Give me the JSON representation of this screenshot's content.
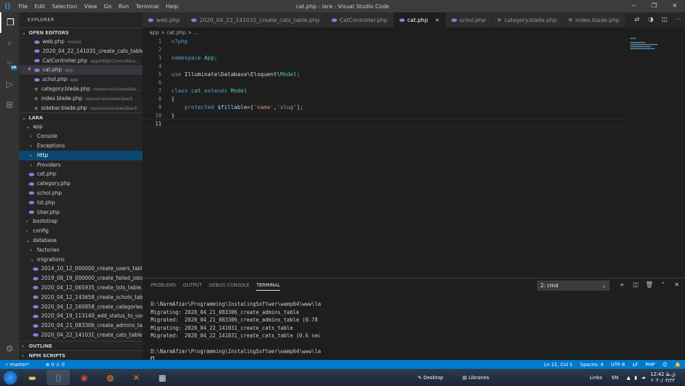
{
  "window": {
    "title": "cat.php - lara - Visual Studio Code",
    "menu": [
      "File",
      "Edit",
      "Selection",
      "View",
      "Go",
      "Run",
      "Terminal",
      "Help"
    ]
  },
  "activity_badge": "SK",
  "sidebar": {
    "header": "EXPLORER",
    "open_editors_title": "OPEN EDITORS",
    "open_editors": [
      {
        "name": "web.php",
        "path": "routes"
      },
      {
        "name": "2020_04_22_141031_create_cats_table...",
        "path": ""
      },
      {
        "name": "CatController.php",
        "path": "app\\Http\\Controllers..."
      },
      {
        "name": "cat.php",
        "path": "app"
      },
      {
        "name": "schol.php",
        "path": "app"
      },
      {
        "name": "category.blade.php",
        "path": "resources\\views\\ba..."
      },
      {
        "name": "index.blade.php",
        "path": "resources\\views\\back"
      },
      {
        "name": "sidebar.blade.php",
        "path": "resources\\views\\back"
      }
    ],
    "project_title": "LARA",
    "tree": [
      "app",
      "Console",
      "Exceptions",
      "Http",
      "Providers",
      "cat.php",
      "category.php",
      "schol.php",
      "tst.php",
      "User.php",
      "bootstrap",
      "config",
      "database",
      "factories",
      "migrations",
      "2014_10_12_000000_create_users_table....",
      "2019_08_19_000000_create_failed_jobs...",
      "2020_04_12_065935_create_tsts_table.p...",
      "2020_04_12_143658_create_schols_tabl...",
      "2020_04_12_160858_create_categories_...",
      "2020_04_19_113140_add_status_to_use...",
      "2020_04_21_083306_create_admins_ta...",
      "2020_04_22_141031_create_cats_table...."
    ],
    "outline_title": "OUTLINE",
    "npm_title": "NPM SCRIPTS"
  },
  "tabs": [
    "web.php",
    "2020_04_22_141031_create_cats_table.php",
    "CatController.php",
    "cat.php",
    "schol.php",
    "category.blade.php",
    "index.blade.php"
  ],
  "breadcrumb": "app > cat.php > ...",
  "code": {
    "line_numbers": [
      "1",
      "2",
      "3",
      "4",
      "5",
      "6",
      "7",
      "8",
      "9",
      "10",
      "11"
    ],
    "l1": "<?php",
    "l3_kw": "namespace",
    "l3_rest": " App;",
    "l5_kw": "use",
    "l5_a": " Illuminate",
    "l5_b": "\\Database\\Eloquent\\",
    "l5_c": "Model",
    "l5_d": ";",
    "l7_kw": "class",
    "l7_name": " cat",
    "l7_kw2": " extends",
    "l7_base": " Model",
    "l8": "{",
    "l9_kw": "protected",
    "l9_var": " $fillable",
    "l9_a": "=[",
    "l9_s1": "'name'",
    "l9_c": ",",
    "l9_s2": "'slug'",
    "l9_e": "];",
    "l10": "}"
  },
  "panel": {
    "tabs": [
      "PROBLEMS",
      "OUTPUT",
      "DEBUG CONSOLE",
      "TERMINAL"
    ],
    "terminal_select": "2: cmd",
    "terminal_lines": [
      "D:\\NarmAfzar\\Programming\\InstalingSoftwer\\wamp64\\www\\la",
      "Migrating: 2020_04_21_083306_create_admins_table",
      "Migrated:  2020_04_21_083306_create_admins_table (0.78",
      "Migrating: 2020_04_22_141031_create_cats_table",
      "Migrated:  2020_04_22_141031_create_cats_table (0.6 sec",
      "",
      "D:\\NarmAfzar\\Programming\\InstalingSoftwer\\wamp64\\www\\la"
    ]
  },
  "status": {
    "branch": "master*",
    "problems": "⊗ 0 ⚠ 0",
    "position": "Ln 11, Col 1",
    "spaces": "Spaces: 4",
    "encoding": "UTF-8",
    "eol": "LF",
    "language": "PHP"
  },
  "taskbar": {
    "desktop": "Desktop",
    "libraries": "Libraries",
    "links": "Links",
    "lang": "EN",
    "time": "12:42 ق.ظ",
    "date": "۲۰۲۰/۰۴/۲۳"
  }
}
